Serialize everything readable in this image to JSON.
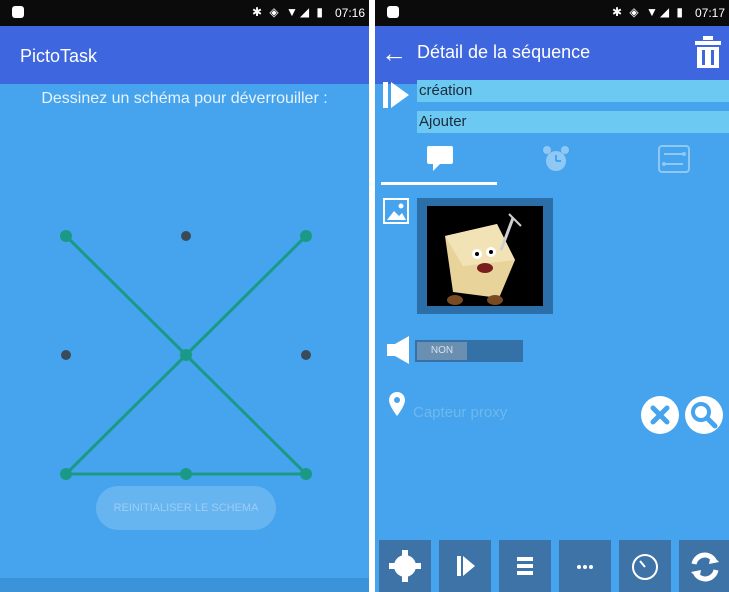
{
  "left": {
    "status_time": "07:16",
    "app_title": "PictoTask",
    "prompt": "Dessinez un schéma pour déverrouiller :",
    "pattern": {
      "dots": [
        "1",
        "2",
        "3",
        "4",
        "5",
        "6",
        "7",
        "8",
        "9"
      ],
      "sequence": [
        1,
        5,
        9,
        8,
        7,
        5,
        3
      ]
    },
    "ghost_button": "REINITIALISER LE SCHEMA"
  },
  "right": {
    "status_time": "07:17",
    "app_title": "Détail de la séquence",
    "field_1": "création",
    "field_2": "Ajouter",
    "tabs": [
      "message-icon",
      "alarm-clock-icon",
      "routes-icon"
    ],
    "active_tab": "message-icon",
    "toggle_label": "NON",
    "proxy_placeholder": "Capteur proxy",
    "bottom_icons": [
      "settings-icon",
      "play-icon",
      "list-icon",
      "more-icon",
      "timer-icon",
      "refresh-icon"
    ]
  },
  "colors": {
    "appbar": "#3e66df",
    "background": "#45a4ed",
    "pattern_line": "#1a9a86",
    "field_bg": "#6ccaf2"
  }
}
